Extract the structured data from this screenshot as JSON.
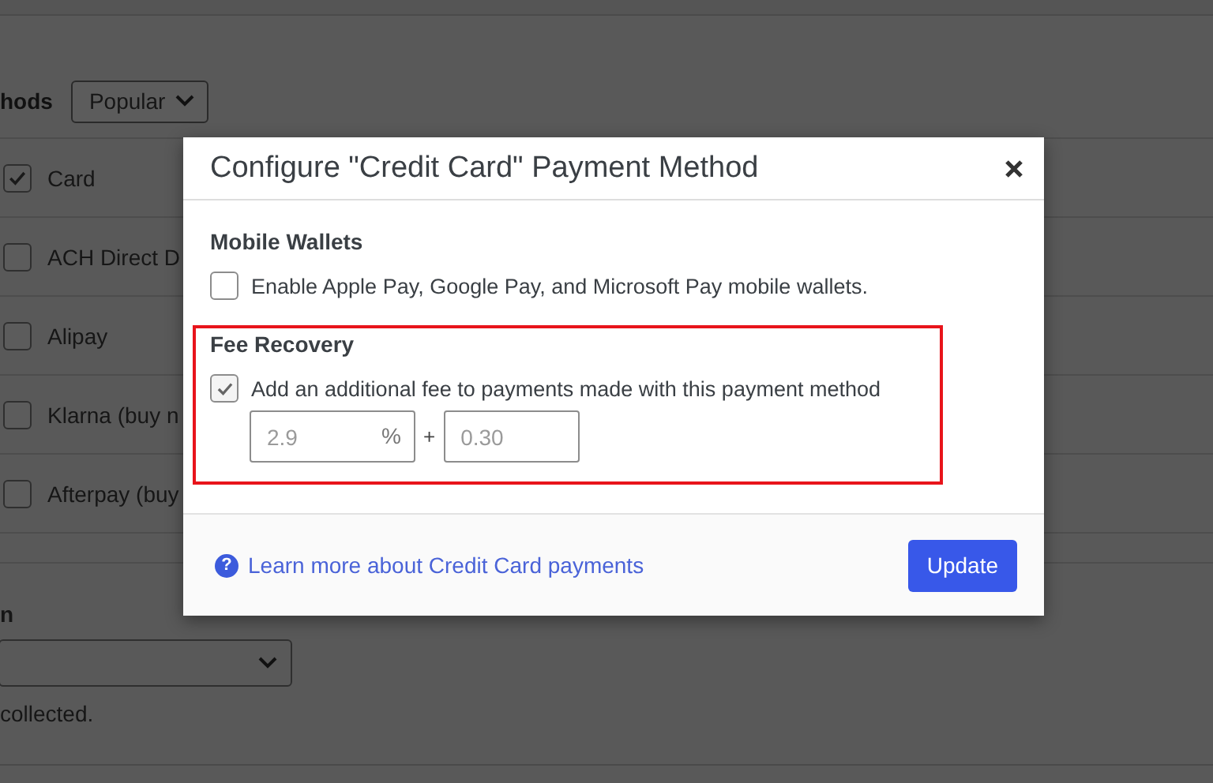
{
  "background_page": {
    "methods_label": "hods",
    "filter_dropdown": {
      "value": "Popular"
    },
    "methods": [
      {
        "label": "Card",
        "checked": true
      },
      {
        "label": "ACH Direct D",
        "checked": false
      },
      {
        "label": "Alipay",
        "checked": false
      },
      {
        "label": "Klarna (buy n",
        "checked": false
      },
      {
        "label": "Afterpay (buy",
        "checked": false
      }
    ],
    "section_label": "n",
    "note": "collected."
  },
  "dialog": {
    "title": "Configure \"Credit Card\" Payment Method",
    "sections": [
      {
        "heading": "Mobile Wallets",
        "highlighted": false,
        "option": {
          "label": "Enable Apple Pay, Google Pay, and Microsoft Pay mobile wallets.",
          "checked": false
        }
      },
      {
        "heading": "Fee Recovery",
        "highlighted": true,
        "option": {
          "label": "Add an additional fee to payments made with this payment method",
          "checked": true
        },
        "fee_inputs": {
          "percent": {
            "placeholder": "2.9",
            "suffix": "%"
          },
          "separator": "+",
          "fixed": {
            "placeholder": "0.30"
          }
        }
      }
    ],
    "footer": {
      "help_icon": "?",
      "help_link": "Learn more about Credit Card payments",
      "button": "Update"
    }
  }
}
